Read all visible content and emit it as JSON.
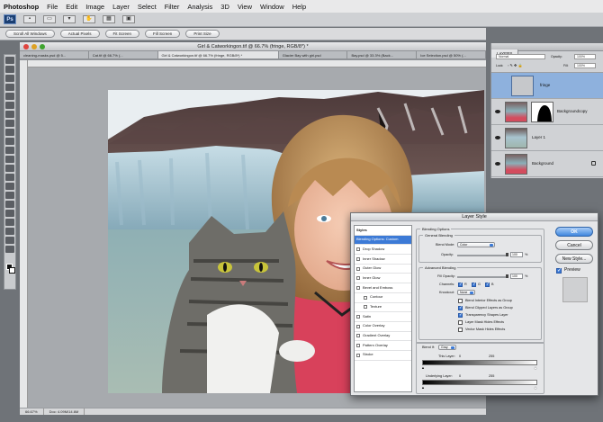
{
  "menubar": {
    "app": "Photoshop",
    "items": [
      "File",
      "Edit",
      "Image",
      "Layer",
      "Select",
      "Filter",
      "Analysis",
      "3D",
      "View",
      "Window",
      "Help"
    ]
  },
  "options_bar": {
    "buttons": [
      "Scroll All Windows",
      "Actual Pixels",
      "Fit Screen",
      "Fill Screen",
      "Print Size"
    ]
  },
  "document": {
    "title": "Girl & Catworkingon.tif @ 66.7% (fringe, RGB/8*) *",
    "tabs": [
      "cleaning-masks.psd @ 5...",
      "Cat.tif @ 66.7% (...",
      "Girl & Catworkingon.tif @ 66.7% (fringe, RGB/8*) *",
      "Glacier Bay with girl.psd",
      "Bay.psd @ 33.3% (Back...",
      "Ice Selection.psd @ 50% (..."
    ],
    "zoom": "66.67%",
    "doc_size": "Doc: 4.09M/14.6M"
  },
  "layers_panel": {
    "tabs": [
      "LAYERS"
    ],
    "blend_mode": "Normal",
    "opacity_label": "Opacity:",
    "opacity": "100%",
    "lock_label": "Lock:",
    "fill_label": "Fill:",
    "fill": "100%",
    "layers": [
      {
        "name": "fringe",
        "selected": true
      },
      {
        "name": "Backgroundcopy",
        "selected": false
      },
      {
        "name": "Layer 1",
        "selected": false
      },
      {
        "name": "Background",
        "selected": false
      }
    ]
  },
  "layer_style": {
    "title": "Layer Style",
    "styles_header": "Styles",
    "styles": [
      {
        "label": "Blending Options: Custom",
        "selected": true,
        "checkbox": false,
        "sub": false
      },
      {
        "label": "Drop Shadow",
        "selected": false,
        "checkbox": true,
        "sub": false
      },
      {
        "label": "Inner Shadow",
        "selected": false,
        "checkbox": true,
        "sub": false
      },
      {
        "label": "Outer Glow",
        "selected": false,
        "checkbox": true,
        "sub": false
      },
      {
        "label": "Inner Glow",
        "selected": false,
        "checkbox": true,
        "sub": false
      },
      {
        "label": "Bevel and Emboss",
        "selected": false,
        "checkbox": true,
        "sub": false
      },
      {
        "label": "Contour",
        "selected": false,
        "checkbox": true,
        "sub": true
      },
      {
        "label": "Texture",
        "selected": false,
        "checkbox": true,
        "sub": true
      },
      {
        "label": "Satin",
        "selected": false,
        "checkbox": true,
        "sub": false
      },
      {
        "label": "Color Overlay",
        "selected": false,
        "checkbox": true,
        "sub": false
      },
      {
        "label": "Gradient Overlay",
        "selected": false,
        "checkbox": true,
        "sub": false
      },
      {
        "label": "Pattern Overlay",
        "selected": false,
        "checkbox": true,
        "sub": false
      },
      {
        "label": "Stroke",
        "selected": false,
        "checkbox": true,
        "sub": false
      }
    ],
    "blending_options": "Blending Options",
    "general": {
      "header": "General Blending",
      "blend_mode_label": "Blend Mode:",
      "blend_mode": "Color",
      "opacity_label": "Opacity:",
      "opacity": "100",
      "unit": "%"
    },
    "advanced": {
      "header": "Advanced Blending",
      "fill_label": "Fill Opacity:",
      "fill": "100",
      "unit": "%",
      "channels_label": "Channels:",
      "channels": [
        "R",
        "G",
        "B"
      ],
      "knockout_label": "Knockout:",
      "knockout": "None",
      "options": [
        {
          "label": "Blend Interior Effects as Group",
          "checked": false
        },
        {
          "label": "Blend Clipped Layers as Group",
          "checked": true
        },
        {
          "label": "Transparency Shapes Layer",
          "checked": true
        },
        {
          "label": "Layer Mask Hides Effects",
          "checked": false
        },
        {
          "label": "Vector Mask Hides Effects",
          "checked": false
        }
      ]
    },
    "blend_if": {
      "label": "Blend If:",
      "value": "Gray",
      "this_layer_label": "This Layer:",
      "this_layer_low": "0",
      "this_layer_high": "255",
      "underlying_label": "Underlying Layer:",
      "underlying_low": "0",
      "underlying_high": "255"
    },
    "buttons": {
      "ok": "OK",
      "cancel": "Cancel",
      "new_style": "New Style...",
      "preview": "Preview"
    }
  },
  "colors": {
    "accent": "#3c7ad6",
    "layer_selected": "#8eb1dd"
  }
}
